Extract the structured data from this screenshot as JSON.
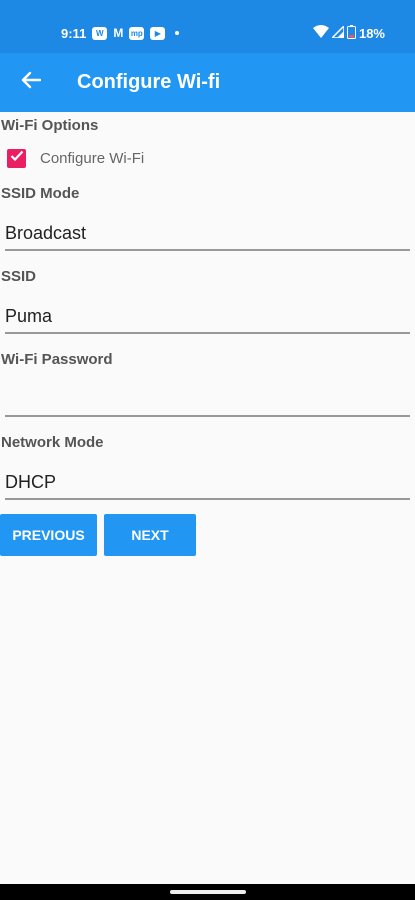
{
  "status_bar": {
    "time": "9:11",
    "notification_icons": [
      "W",
      "M",
      "mp",
      "▶"
    ],
    "battery": "18%",
    "background_color": "#1e88e5"
  },
  "app_bar": {
    "title": "Configure Wi-fi",
    "back_icon": "arrow-left-icon",
    "background_color": "#2196f3"
  },
  "form": {
    "wifi_options_label": "Wi-Fi Options",
    "configure_wifi": {
      "label": "Configure Wi-Fi",
      "checked": true,
      "color": "#e91e63"
    },
    "ssid_mode": {
      "label": "SSID Mode",
      "value": "Broadcast"
    },
    "ssid": {
      "label": "SSID",
      "value": "Puma"
    },
    "wifi_password": {
      "label": "Wi-Fi Password",
      "value": ""
    },
    "network_mode": {
      "label": "Network Mode",
      "value": "DHCP"
    }
  },
  "buttons": {
    "previous": "PREVIOUS",
    "next": "NEXT"
  }
}
